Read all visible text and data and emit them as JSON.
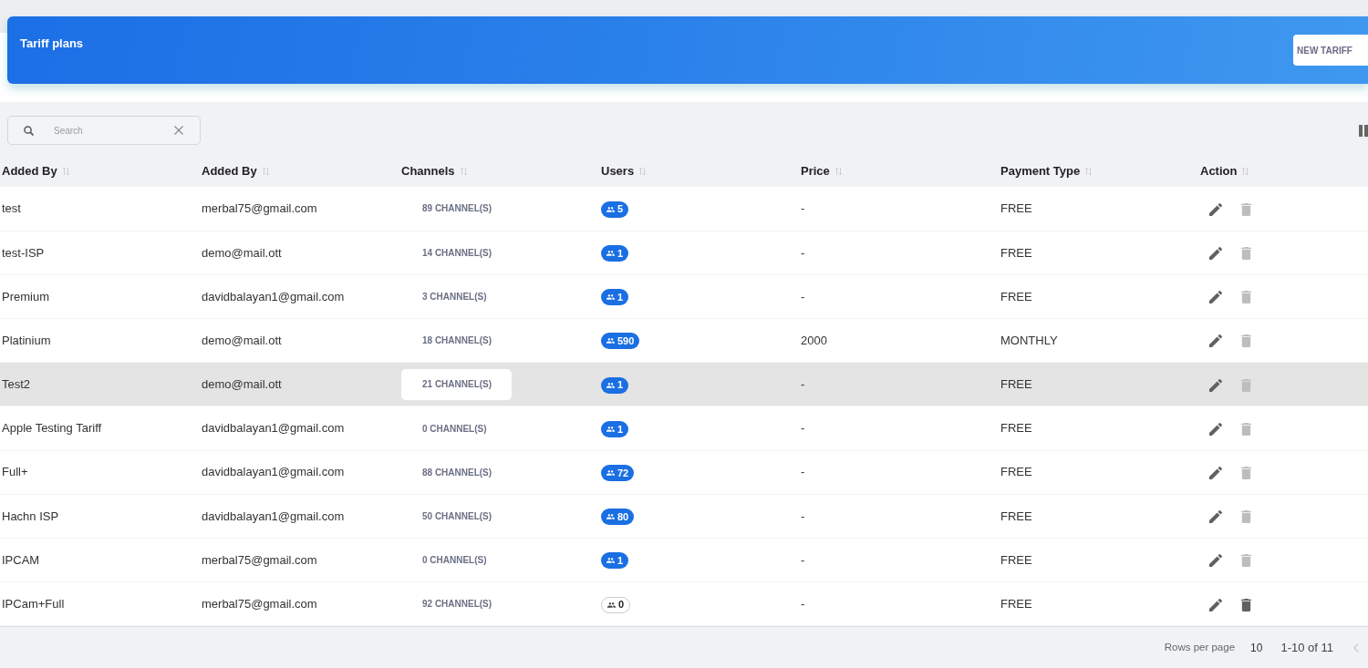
{
  "header": {
    "title": "Tariff plans",
    "button": "NEW TARIFF"
  },
  "search": {
    "placeholder": "Search"
  },
  "table": {
    "columns": [
      {
        "label": "Added By"
      },
      {
        "label": "Added By"
      },
      {
        "label": "Channels"
      },
      {
        "label": "Users"
      },
      {
        "label": "Price"
      },
      {
        "label": "Payment Type"
      },
      {
        "label": "Action"
      }
    ],
    "rows": [
      {
        "name": "test",
        "added_by": "merbal75@gmail.com",
        "channels": "89 CHANNEL(S)",
        "users": {
          "count": "5",
          "filled": true
        },
        "price": "-",
        "payment_type": "FREE",
        "hovered": false,
        "delete_disabled": true
      },
      {
        "name": "test-ISP",
        "added_by": "demo@mail.ott",
        "channels": "14 CHANNEL(S)",
        "users": {
          "count": "1",
          "filled": true
        },
        "price": "-",
        "payment_type": "FREE",
        "hovered": false,
        "delete_disabled": true
      },
      {
        "name": "Premium",
        "added_by": "davidbalayan1@gmail.com",
        "channels": "3 CHANNEL(S)",
        "users": {
          "count": "1",
          "filled": true
        },
        "price": "-",
        "payment_type": "FREE",
        "hovered": false,
        "delete_disabled": true
      },
      {
        "name": "Platinium",
        "added_by": "demo@mail.ott",
        "channels": "18 CHANNEL(S)",
        "users": {
          "count": "590",
          "filled": true
        },
        "price": "2000",
        "payment_type": "MONTHLY",
        "hovered": false,
        "delete_disabled": true
      },
      {
        "name": "Test2",
        "added_by": "demo@mail.ott",
        "channels": "21 CHANNEL(S)",
        "users": {
          "count": "1",
          "filled": true
        },
        "price": "-",
        "payment_type": "FREE",
        "hovered": true,
        "delete_disabled": true
      },
      {
        "name": "Apple Testing Tariff",
        "added_by": "davidbalayan1@gmail.com",
        "channels": "0 CHANNEL(S)",
        "users": {
          "count": "1",
          "filled": true
        },
        "price": "-",
        "payment_type": "FREE",
        "hovered": false,
        "delete_disabled": true
      },
      {
        "name": "Full+",
        "added_by": "davidbalayan1@gmail.com",
        "channels": "88 CHANNEL(S)",
        "users": {
          "count": "72",
          "filled": true
        },
        "price": "-",
        "payment_type": "FREE",
        "hovered": false,
        "delete_disabled": true
      },
      {
        "name": "Hachn ISP",
        "added_by": "davidbalayan1@gmail.com",
        "channels": "50 CHANNEL(S)",
        "users": {
          "count": "80",
          "filled": true
        },
        "price": "-",
        "payment_type": "FREE",
        "hovered": false,
        "delete_disabled": true
      },
      {
        "name": "IPCAM",
        "added_by": "merbal75@gmail.com",
        "channels": "0 CHANNEL(S)",
        "users": {
          "count": "1",
          "filled": true
        },
        "price": "-",
        "payment_type": "FREE",
        "hovered": false,
        "delete_disabled": true
      },
      {
        "name": "IPCam+Full",
        "added_by": "merbal75@gmail.com",
        "channels": "92 CHANNEL(S)",
        "users": {
          "count": "0",
          "filled": false
        },
        "price": "-",
        "payment_type": "FREE",
        "hovered": false,
        "delete_disabled": false
      }
    ]
  },
  "pagination": {
    "rows_per_page_label": "Rows per page",
    "rows_per_page": "10",
    "range": "1-10 of 11"
  }
}
